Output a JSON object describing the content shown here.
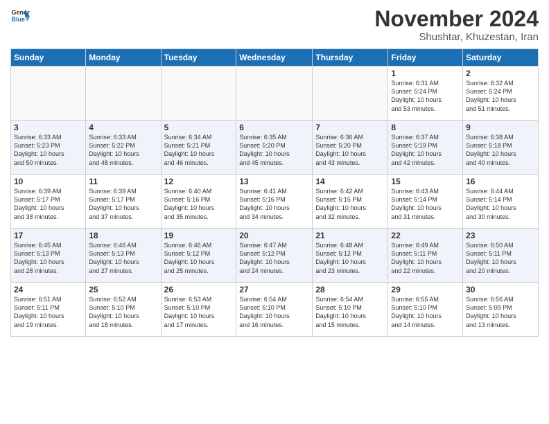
{
  "header": {
    "logo": {
      "general": "General",
      "blue": "Blue"
    },
    "title": "November 2024",
    "location": "Shushtar, Khuzestan, Iran"
  },
  "calendar": {
    "days": [
      "Sunday",
      "Monday",
      "Tuesday",
      "Wednesday",
      "Thursday",
      "Friday",
      "Saturday"
    ],
    "weeks": [
      [
        {
          "day": null,
          "info": null
        },
        {
          "day": null,
          "info": null
        },
        {
          "day": null,
          "info": null
        },
        {
          "day": null,
          "info": null
        },
        {
          "day": null,
          "info": null
        },
        {
          "day": "1",
          "info": "Sunrise: 6:31 AM\nSunset: 5:24 PM\nDaylight: 10 hours\nand 53 minutes."
        },
        {
          "day": "2",
          "info": "Sunrise: 6:32 AM\nSunset: 5:24 PM\nDaylight: 10 hours\nand 51 minutes."
        }
      ],
      [
        {
          "day": "3",
          "info": "Sunrise: 6:33 AM\nSunset: 5:23 PM\nDaylight: 10 hours\nand 50 minutes."
        },
        {
          "day": "4",
          "info": "Sunrise: 6:33 AM\nSunset: 5:22 PM\nDaylight: 10 hours\nand 48 minutes."
        },
        {
          "day": "5",
          "info": "Sunrise: 6:34 AM\nSunset: 5:21 PM\nDaylight: 10 hours\nand 46 minutes."
        },
        {
          "day": "6",
          "info": "Sunrise: 6:35 AM\nSunset: 5:20 PM\nDaylight: 10 hours\nand 45 minutes."
        },
        {
          "day": "7",
          "info": "Sunrise: 6:36 AM\nSunset: 5:20 PM\nDaylight: 10 hours\nand 43 minutes."
        },
        {
          "day": "8",
          "info": "Sunrise: 6:37 AM\nSunset: 5:19 PM\nDaylight: 10 hours\nand 42 minutes."
        },
        {
          "day": "9",
          "info": "Sunrise: 6:38 AM\nSunset: 5:18 PM\nDaylight: 10 hours\nand 40 minutes."
        }
      ],
      [
        {
          "day": "10",
          "info": "Sunrise: 6:39 AM\nSunset: 5:17 PM\nDaylight: 10 hours\nand 38 minutes."
        },
        {
          "day": "11",
          "info": "Sunrise: 6:39 AM\nSunset: 5:17 PM\nDaylight: 10 hours\nand 37 minutes."
        },
        {
          "day": "12",
          "info": "Sunrise: 6:40 AM\nSunset: 5:16 PM\nDaylight: 10 hours\nand 35 minutes."
        },
        {
          "day": "13",
          "info": "Sunrise: 6:41 AM\nSunset: 5:16 PM\nDaylight: 10 hours\nand 34 minutes."
        },
        {
          "day": "14",
          "info": "Sunrise: 6:42 AM\nSunset: 5:15 PM\nDaylight: 10 hours\nand 32 minutes."
        },
        {
          "day": "15",
          "info": "Sunrise: 6:43 AM\nSunset: 5:14 PM\nDaylight: 10 hours\nand 31 minutes."
        },
        {
          "day": "16",
          "info": "Sunrise: 6:44 AM\nSunset: 5:14 PM\nDaylight: 10 hours\nand 30 minutes."
        }
      ],
      [
        {
          "day": "17",
          "info": "Sunrise: 6:45 AM\nSunset: 5:13 PM\nDaylight: 10 hours\nand 28 minutes."
        },
        {
          "day": "18",
          "info": "Sunrise: 6:46 AM\nSunset: 5:13 PM\nDaylight: 10 hours\nand 27 minutes."
        },
        {
          "day": "19",
          "info": "Sunrise: 6:46 AM\nSunset: 5:12 PM\nDaylight: 10 hours\nand 25 minutes."
        },
        {
          "day": "20",
          "info": "Sunrise: 6:47 AM\nSunset: 5:12 PM\nDaylight: 10 hours\nand 24 minutes."
        },
        {
          "day": "21",
          "info": "Sunrise: 6:48 AM\nSunset: 5:12 PM\nDaylight: 10 hours\nand 23 minutes."
        },
        {
          "day": "22",
          "info": "Sunrise: 6:49 AM\nSunset: 5:11 PM\nDaylight: 10 hours\nand 22 minutes."
        },
        {
          "day": "23",
          "info": "Sunrise: 6:50 AM\nSunset: 5:11 PM\nDaylight: 10 hours\nand 20 minutes."
        }
      ],
      [
        {
          "day": "24",
          "info": "Sunrise: 6:51 AM\nSunset: 5:11 PM\nDaylight: 10 hours\nand 19 minutes."
        },
        {
          "day": "25",
          "info": "Sunrise: 6:52 AM\nSunset: 5:10 PM\nDaylight: 10 hours\nand 18 minutes."
        },
        {
          "day": "26",
          "info": "Sunrise: 6:53 AM\nSunset: 5:10 PM\nDaylight: 10 hours\nand 17 minutes."
        },
        {
          "day": "27",
          "info": "Sunrise: 6:54 AM\nSunset: 5:10 PM\nDaylight: 10 hours\nand 16 minutes."
        },
        {
          "day": "28",
          "info": "Sunrise: 6:54 AM\nSunset: 5:10 PM\nDaylight: 10 hours\nand 15 minutes."
        },
        {
          "day": "29",
          "info": "Sunrise: 6:55 AM\nSunset: 5:10 PM\nDaylight: 10 hours\nand 14 minutes."
        },
        {
          "day": "30",
          "info": "Sunrise: 6:56 AM\nSunset: 5:09 PM\nDaylight: 10 hours\nand 13 minutes."
        }
      ]
    ]
  }
}
